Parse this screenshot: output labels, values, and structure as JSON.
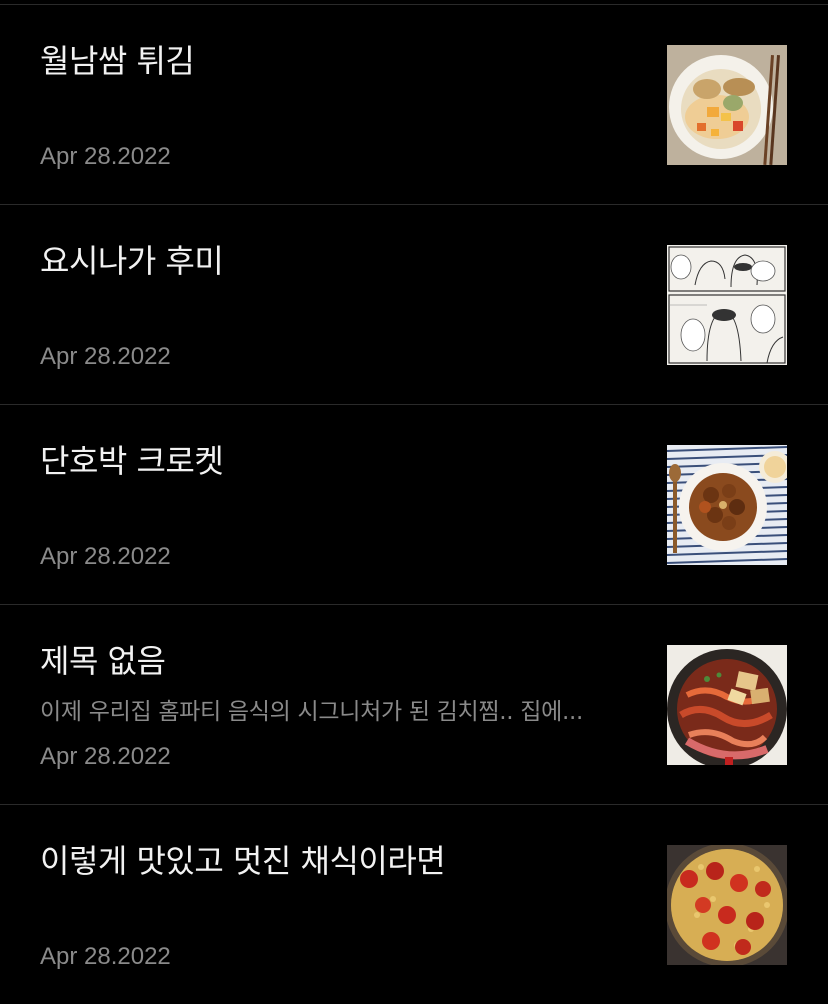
{
  "posts": [
    {
      "title": "월남쌈 튀김",
      "excerpt": "",
      "date": "Apr 28.2022",
      "thumbnail": "fried-spring-rolls-photo"
    },
    {
      "title": "요시나가 후미",
      "excerpt": "",
      "date": "Apr 28.2022",
      "thumbnail": "manga-page-photo"
    },
    {
      "title": "단호박 크로켓",
      "excerpt": "",
      "date": "Apr 28.2022",
      "thumbnail": "pumpkin-croquette-photo"
    },
    {
      "title": "제목 없음",
      "excerpt": "이제 우리집 홈파티 음식의 시그니처가 된 김치찜..  집에...",
      "date": "Apr 28.2022",
      "thumbnail": "kimchi-stew-photo"
    },
    {
      "title": "이렇게 맛있고 멋진 채식이라면",
      "excerpt": "",
      "date": "Apr 28.2022",
      "thumbnail": "paella-photo"
    }
  ]
}
